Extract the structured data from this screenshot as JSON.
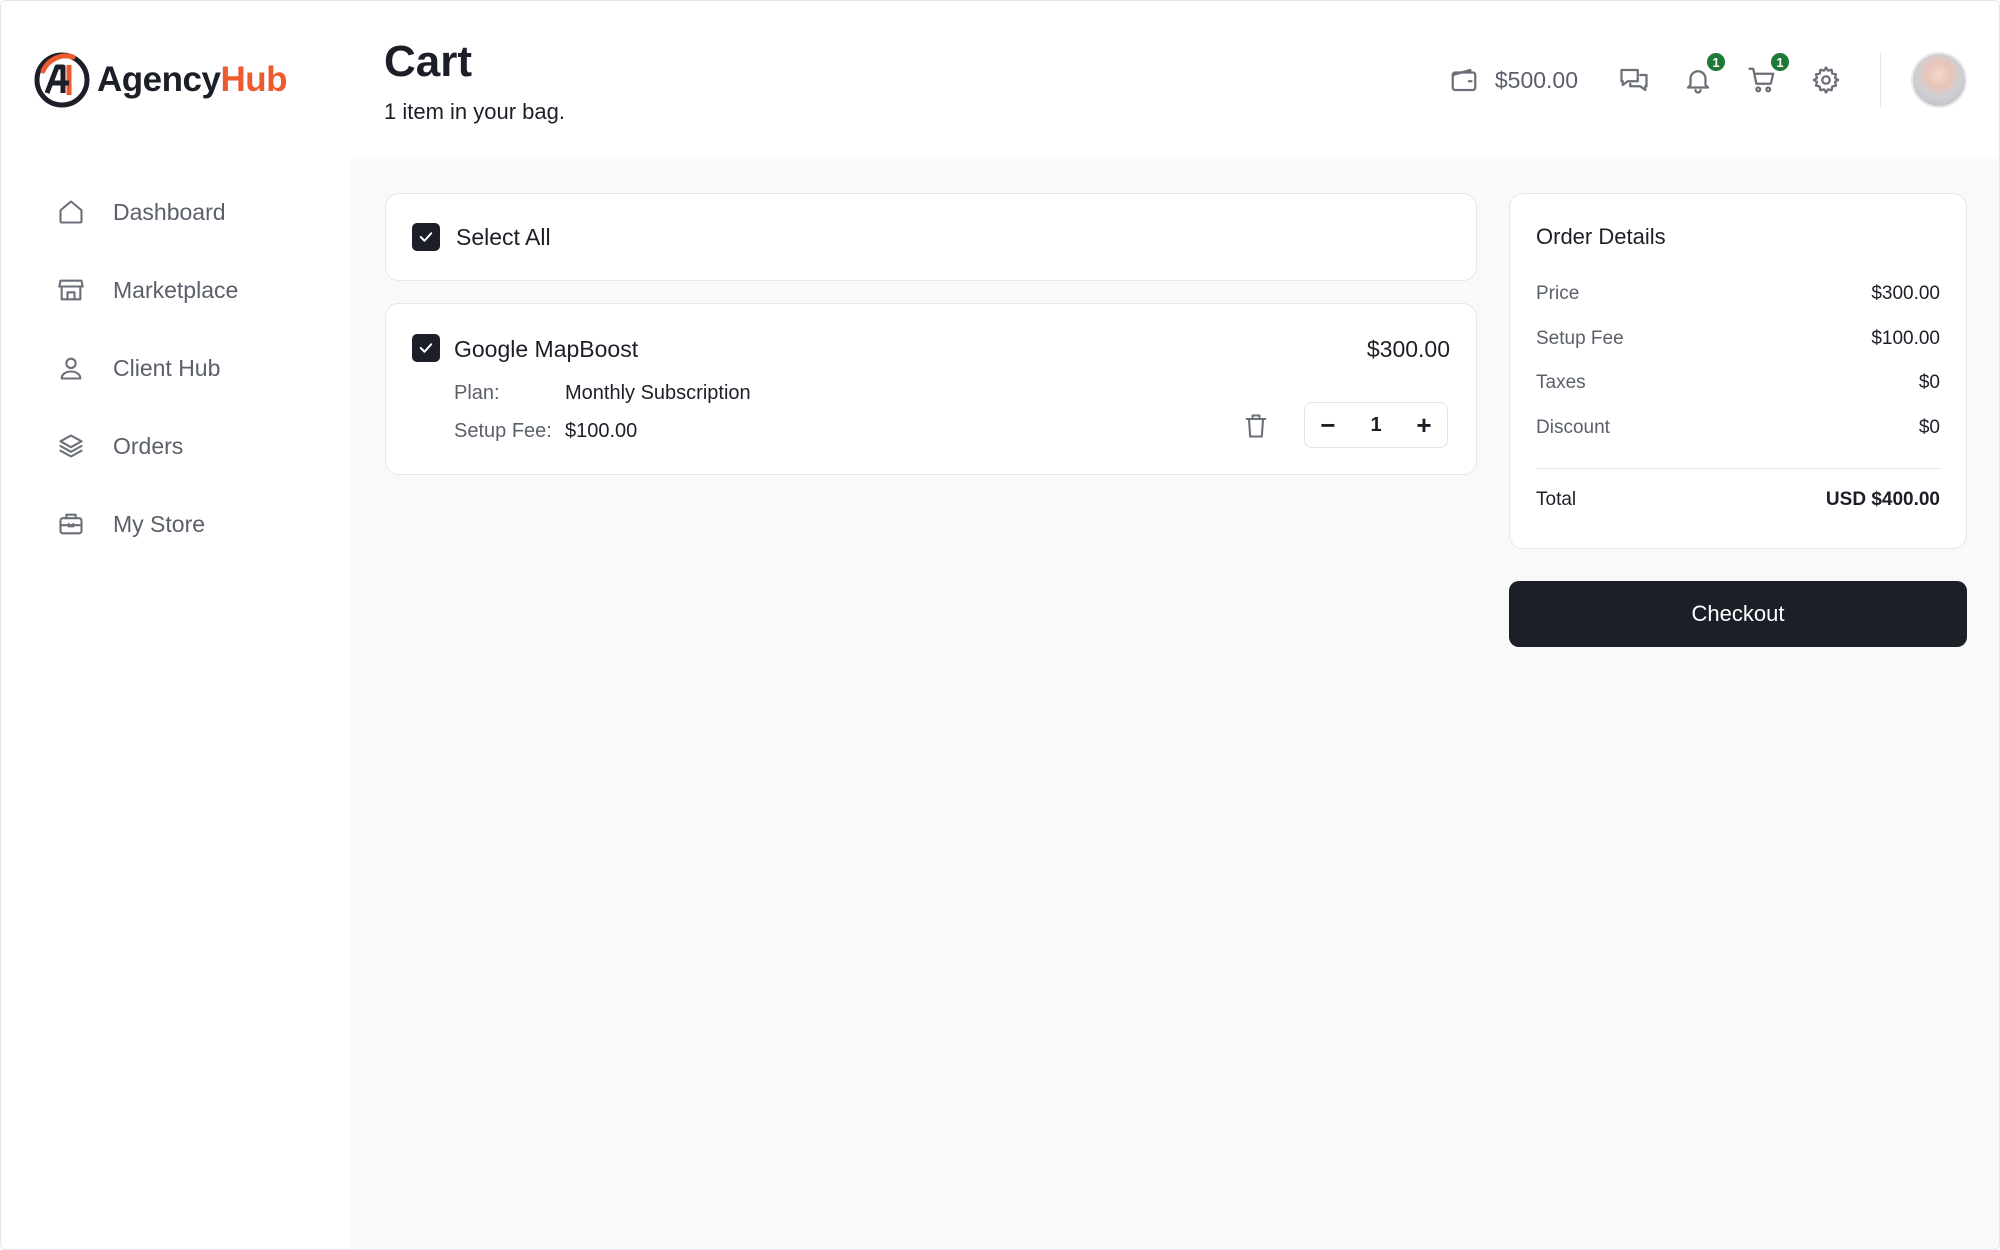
{
  "brand": {
    "name_part1": "Agency",
    "name_part2": "Hub",
    "primary_color": "#ee5a2f",
    "dark_color": "#1c1f27"
  },
  "sidebar": {
    "items": [
      {
        "label": "Dashboard",
        "icon": "home-icon"
      },
      {
        "label": "Marketplace",
        "icon": "store-icon"
      },
      {
        "label": "Client Hub",
        "icon": "user-icon"
      },
      {
        "label": "Orders",
        "icon": "layers-icon"
      },
      {
        "label": "My Store",
        "icon": "briefcase-icon"
      }
    ]
  },
  "header": {
    "title": "Cart",
    "subtitle": "1 item in your bag.",
    "wallet_balance": "$500.00",
    "notifications_count": "1",
    "cart_count": "1",
    "badge_color": "#1f7a3a"
  },
  "cart": {
    "select_all_label": "Select All",
    "items": [
      {
        "name": "Google MapBoost",
        "price": "$300.00",
        "plan_label": "Plan:",
        "plan_value": "Monthly Subscription",
        "setup_fee_label": "Setup Fee:",
        "setup_fee_value": "$100.00",
        "quantity": "1",
        "decrement": "−",
        "increment": "+"
      }
    ]
  },
  "order_details": {
    "title": "Order Details",
    "rows": [
      {
        "label": "Price",
        "value": "$300.00"
      },
      {
        "label": "Setup Fee",
        "value": "$100.00"
      },
      {
        "label": "Taxes",
        "value": "$0"
      },
      {
        "label": "Discount",
        "value": "$0"
      }
    ],
    "total_label": "Total",
    "total_value": "USD $400.00",
    "checkout_label": "Checkout"
  }
}
